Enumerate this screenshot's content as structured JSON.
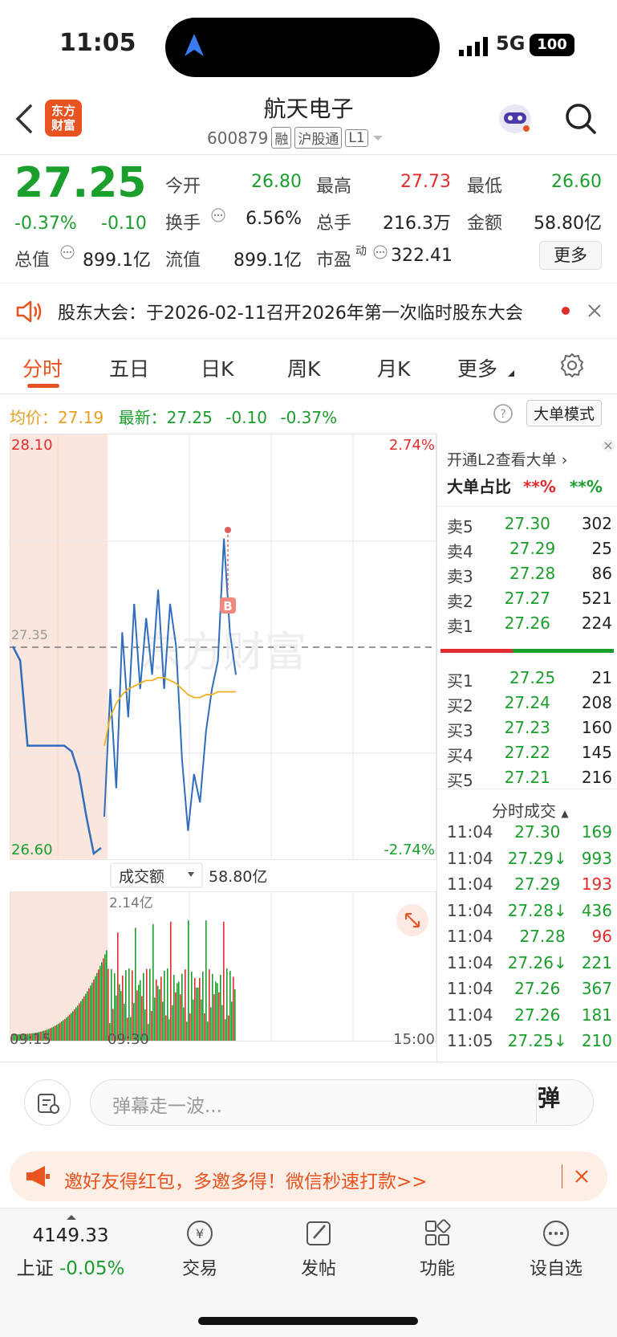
{
  "status": {
    "time": "11:05",
    "network": "5G",
    "battery": "100"
  },
  "header": {
    "logo_line1": "东方",
    "logo_line2": "财富",
    "stock_name": "航天电子",
    "stock_code": "600879",
    "tags": [
      "融",
      "沪股通",
      "L1"
    ]
  },
  "quote": {
    "price": "27.25",
    "change_pct": "-0.37%",
    "change_abs": "-0.10",
    "fields": {
      "open_label": "今开",
      "open": "26.80",
      "high_label": "最高",
      "high": "27.73",
      "low_label": "最低",
      "low": "26.60",
      "turnover_label": "换手",
      "turnover": "6.56%",
      "volume_label": "总手",
      "volume": "216.3万",
      "amount_label": "金额",
      "amount": "58.80亿",
      "mktcap_label": "总值",
      "mktcap": "899.1亿",
      "float_label": "流值",
      "float": "899.1亿",
      "pe_label": "市盈",
      "pe_sup": "动",
      "pe": "322.41"
    },
    "more_label": "更多"
  },
  "notice": {
    "text": "股东大会：于2026-02-11召开2026年第一次临时股东大会"
  },
  "tabs": [
    "分时",
    "五日",
    "日K",
    "周K",
    "月K",
    "更多"
  ],
  "info_line": {
    "avg_label": "均价：",
    "avg": "27.19",
    "latest_label": "最新：",
    "latest": "27.25",
    "chg": "-0.10",
    "pct": "-0.37%",
    "mode_label": "大单模式"
  },
  "chart_data": {
    "type": "line",
    "title": "",
    "price_axis": {
      "max": "28.10",
      "min": "26.60",
      "mid": "27.35",
      "max_pct": "2.74%",
      "min_pct": "-2.74%"
    },
    "watermark": "东方财富",
    "x_ticks": [
      "09:15",
      "09:30",
      "15:00"
    ],
    "price_series": {
      "preopen": [
        27.35,
        27.3,
        27.0,
        27.0,
        27.0,
        27.0,
        27.0,
        27.0,
        26.98,
        26.9,
        26.75,
        26.62,
        26.64
      ],
      "session": [
        26.75,
        27.2,
        26.85,
        27.4,
        27.1,
        27.5,
        27.2,
        27.45,
        27.25,
        27.55,
        27.2,
        27.5,
        27.35,
        26.95,
        26.7,
        26.9,
        26.8,
        27.05,
        27.2,
        27.3,
        27.73,
        27.4,
        27.25
      ],
      "avg": [
        27.0,
        27.1,
        27.15,
        27.18,
        27.2,
        27.21,
        27.22,
        27.23,
        27.23,
        27.24,
        27.24,
        27.23,
        27.22,
        27.2,
        27.18,
        27.17,
        27.17,
        27.18,
        27.18,
        27.19,
        27.19,
        27.19,
        27.19
      ]
    },
    "marker": "B",
    "volume_label": "成交额",
    "volume_total": "58.80亿",
    "volume_max": "2.14亿"
  },
  "order_book": {
    "l2_label": "开通L2查看大单",
    "big_ratio_label": "大单占比",
    "big_ratio_buy": "**%",
    "big_ratio_sell": "**%",
    "asks": [
      {
        "label": "卖5",
        "price": "27.30",
        "vol": "302"
      },
      {
        "label": "卖4",
        "price": "27.29",
        "vol": "25"
      },
      {
        "label": "卖3",
        "price": "27.28",
        "vol": "86"
      },
      {
        "label": "卖2",
        "price": "27.27",
        "vol": "521"
      },
      {
        "label": "卖1",
        "price": "27.26",
        "vol": "224"
      }
    ],
    "bids": [
      {
        "label": "买1",
        "price": "27.25",
        "vol": "21"
      },
      {
        "label": "买2",
        "price": "27.24",
        "vol": "208"
      },
      {
        "label": "买3",
        "price": "27.23",
        "vol": "160"
      },
      {
        "label": "买4",
        "price": "27.22",
        "vol": "145"
      },
      {
        "label": "买5",
        "price": "27.21",
        "vol": "216"
      }
    ],
    "trades_label": "分时成交",
    "trades": [
      {
        "time": "11:04",
        "price": "27.30",
        "vol": "169",
        "color": "green"
      },
      {
        "time": "11:04",
        "price": "27.29↓",
        "vol": "993",
        "color": "green"
      },
      {
        "time": "11:04",
        "price": "27.29",
        "vol": "193",
        "color": "red"
      },
      {
        "time": "11:04",
        "price": "27.28↓",
        "vol": "436",
        "color": "green"
      },
      {
        "time": "11:04",
        "price": "27.28",
        "vol": "96",
        "color": "red"
      },
      {
        "time": "11:04",
        "price": "27.26↓",
        "vol": "221",
        "color": "green"
      },
      {
        "time": "11:04",
        "price": "27.26",
        "vol": "367",
        "color": "green"
      },
      {
        "time": "11:04",
        "price": "27.26",
        "vol": "181",
        "color": "green"
      },
      {
        "time": "11:05",
        "price": "27.25↓",
        "vol": "210",
        "color": "green"
      }
    ]
  },
  "barrage": {
    "placeholder": "弹幕走一波...",
    "button": "弹"
  },
  "promo": {
    "text": "邀好友得红包，多邀多得！微信秒速打款>>"
  },
  "bottom_nav": {
    "index_value": "4149.33",
    "index_name": "上证",
    "index_pct": "-0.05%",
    "items": [
      "交易",
      "发帖",
      "功能",
      "设自选"
    ]
  }
}
